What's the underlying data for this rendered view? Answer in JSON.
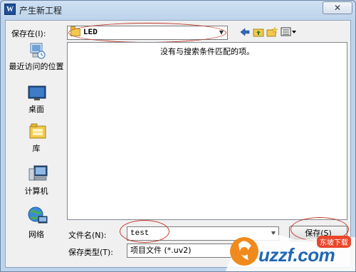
{
  "window": {
    "title": "产生新工程",
    "app_icon_text": "W",
    "close_label": "✕"
  },
  "toolbar": {
    "look_in_label": "保存在(I):",
    "current_folder": "LED",
    "icons": [
      "back-arrow-icon",
      "up-folder-icon",
      "new-folder-icon",
      "view-menu-icon"
    ]
  },
  "places": [
    {
      "label": "最近访问的位置",
      "icon": "recent-places-icon"
    },
    {
      "label": "桌面",
      "icon": "desktop-icon"
    },
    {
      "label": "库",
      "icon": "libraries-icon"
    },
    {
      "label": "计算机",
      "icon": "computer-icon"
    },
    {
      "label": "网络",
      "icon": "network-icon"
    }
  ],
  "file_list": {
    "empty_message": "没有与搜索条件匹配的项。"
  },
  "form": {
    "filename_label": "文件名(N):",
    "filename_value": "test",
    "filetype_label": "保存类型(T):",
    "filetype_value": "项目文件 (*.uv2)",
    "save_button": "保存(S)"
  },
  "watermark": {
    "site": "uzzf.com",
    "badge": "东坡下载"
  }
}
